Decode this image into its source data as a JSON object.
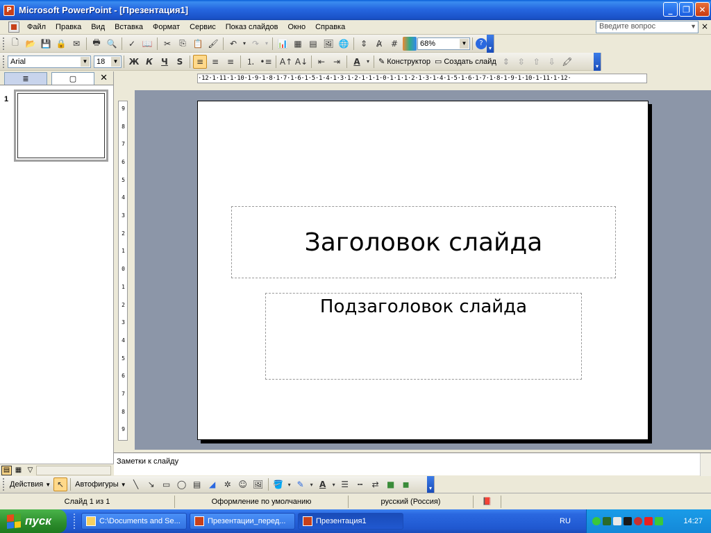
{
  "window": {
    "title": "Microsoft PowerPoint - [Презентация1]",
    "buttons": {
      "minimize": "_",
      "maximize": "❐",
      "close": "✕"
    }
  },
  "menu": {
    "items": [
      "Файл",
      "Правка",
      "Вид",
      "Вставка",
      "Формат",
      "Сервис",
      "Показ слайдов",
      "Окно",
      "Справка"
    ],
    "help_placeholder": "Введите вопрос",
    "close": "×"
  },
  "standard_toolbar": {
    "zoom": "68%"
  },
  "formatting_toolbar": {
    "font": "Arial",
    "size": "18",
    "bold": "Ж",
    "italic": "К",
    "underline": "Ч",
    "shadow": "S",
    "designer": "Конструктор",
    "new_slide": "Создать слайд"
  },
  "left_panel": {
    "slide_number": "1"
  },
  "ruler": {
    "horizontal": "·12·1·11·1·10·1·9·1·8·1·7·1·6·1·5·1·4·1·3·1·2·1·1·1·0·1·1·1·2·1·3·1·4·1·5·1·6·1·7·1·8·1·9·1·10·1·11·1·12·"
  },
  "slide": {
    "title": "Заголовок слайда",
    "subtitle": "Подзаголовок слайда"
  },
  "notes": {
    "placeholder": "Заметки к слайду"
  },
  "drawing_toolbar": {
    "actions": "Действия",
    "autoshapes": "Автофигуры"
  },
  "statusbar": {
    "slide": "Слайд 1 из 1",
    "design": "Оформление по умолчанию",
    "language": "русский (Россия)"
  },
  "taskbar": {
    "start": "пуск",
    "tasks": [
      {
        "label": "C:\\Documents and Se...",
        "active": false
      },
      {
        "label": "Презентации_перед...",
        "active": false
      },
      {
        "label": "Презентация1",
        "active": true
      }
    ],
    "language": "RU",
    "time": "14:27"
  },
  "colors": {
    "titlebar": "#2667e0",
    "workspace": "#8c96a8",
    "taskbar": "#2058d0",
    "start": "#2c8c2c"
  }
}
